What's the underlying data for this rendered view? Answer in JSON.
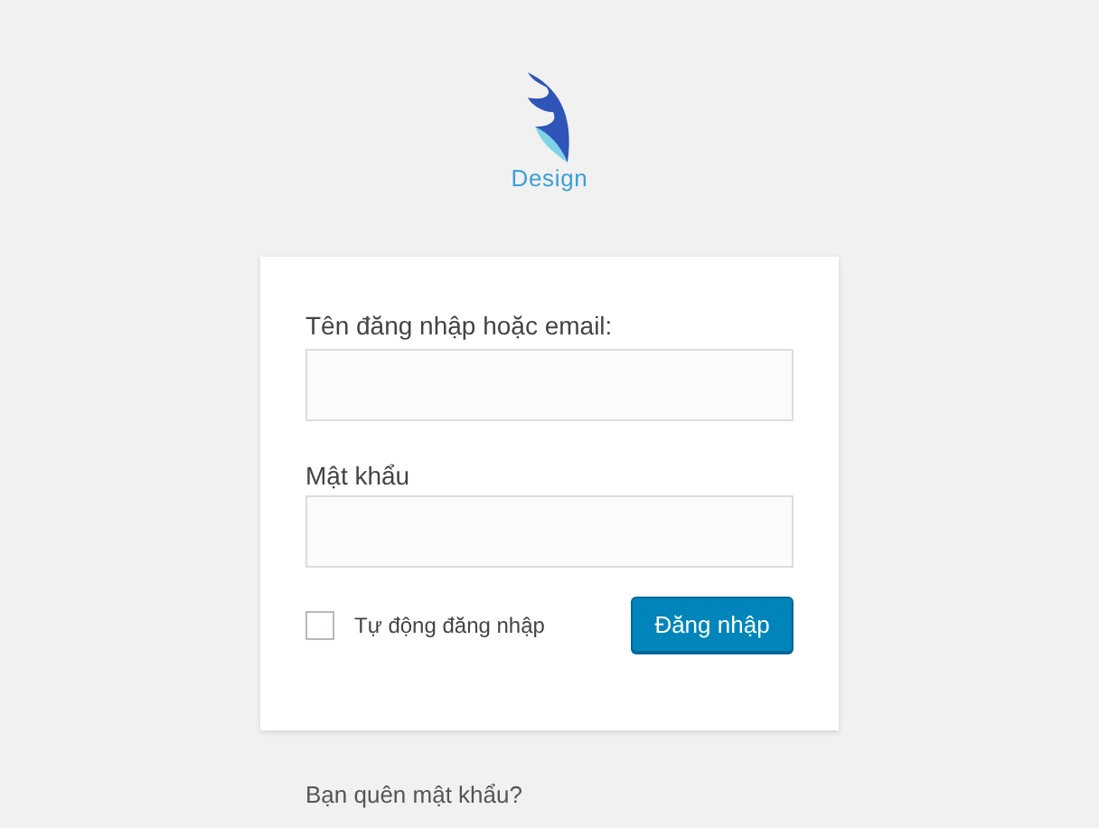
{
  "logo": {
    "text": "Design"
  },
  "form": {
    "username_label": "Tên đăng nhập hoặc email:",
    "password_label": "Mật khẩu",
    "remember": {
      "label": "Tự động đăng nhập",
      "checked": false
    },
    "submit": "Đăng nhập"
  },
  "links": {
    "lost_password": "Bạn quên mật khẩu?"
  }
}
